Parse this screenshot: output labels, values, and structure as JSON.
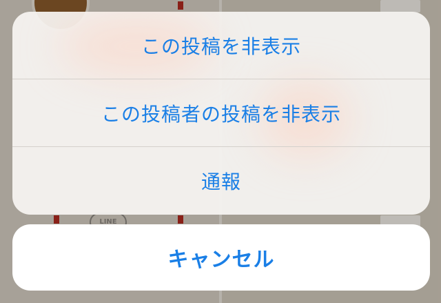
{
  "action_sheet": {
    "actions": [
      {
        "label": "この投稿を非表示"
      },
      {
        "label": "この投稿者の投稿を非表示"
      },
      {
        "label": "通報"
      }
    ],
    "cancel_label": "キャンセル"
  },
  "background": {
    "badge_text": "LINE"
  },
  "colors": {
    "accent": "#1a7fe6",
    "sheet_background": "#f6f3f0",
    "cancel_background": "#ffffff"
  }
}
